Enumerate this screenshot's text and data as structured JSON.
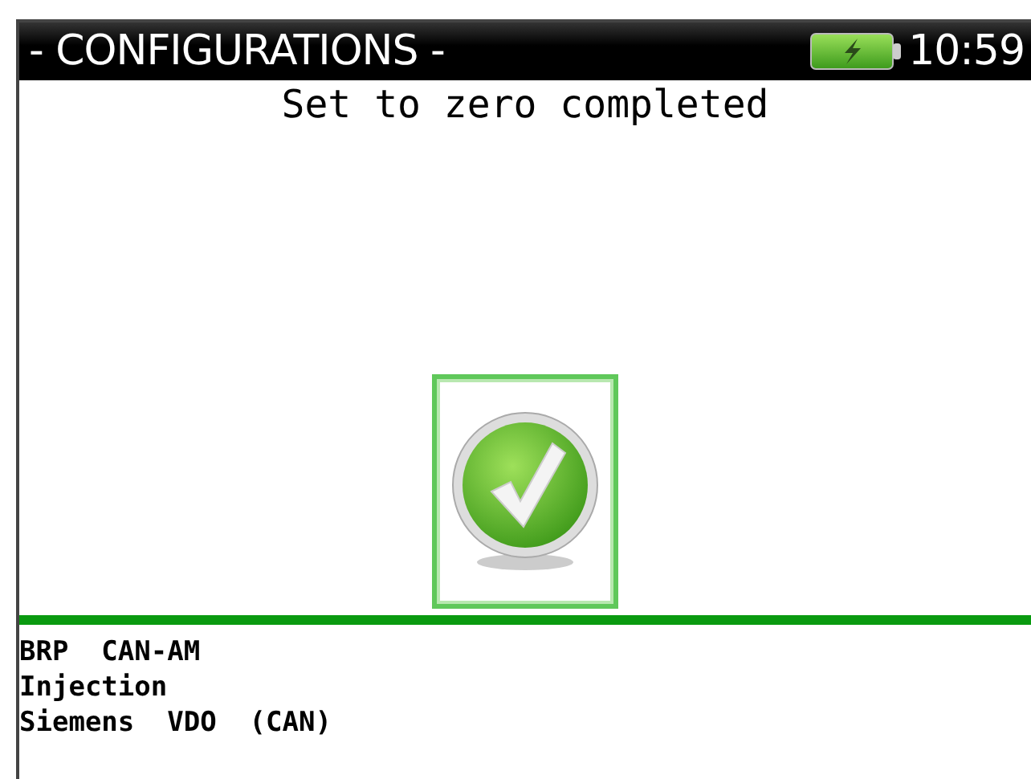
{
  "header": {
    "title": "- CONFIGURATIONS -",
    "time": "10:59"
  },
  "message": "Set to zero completed",
  "info_lines": [
    "BRP  CAN-AM",
    "Injection",
    "Siemens  VDO  (CAN)"
  ]
}
